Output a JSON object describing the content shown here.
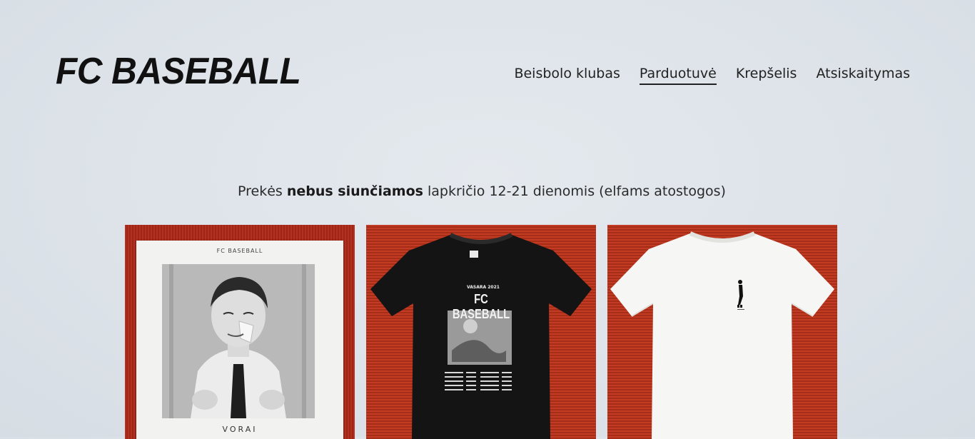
{
  "header": {
    "logo": "FC BASEBALL",
    "nav": [
      {
        "label": "Beisbolo klubas",
        "active": false
      },
      {
        "label": "Parduotuvė",
        "active": true
      },
      {
        "label": "Krepšelis",
        "active": false
      },
      {
        "label": "Atsiskaitymas",
        "active": false
      }
    ]
  },
  "notice": {
    "prefix": "Prekės ",
    "bold": "nebus siunčiamos",
    "suffix": " lapkričio 12-21 dienomis (elfams atostogos)"
  },
  "products": [
    {
      "cover_title": "FC BASEBALL",
      "cover_caption": "VORAI"
    },
    {
      "shirt_heading": "VASARA 2021",
      "shirt_title": "FC BASEBALL"
    },
    {}
  ],
  "colors": {
    "background": "#dde3e9",
    "text": "#1f1f1f",
    "mat_red": "#b4311f"
  }
}
